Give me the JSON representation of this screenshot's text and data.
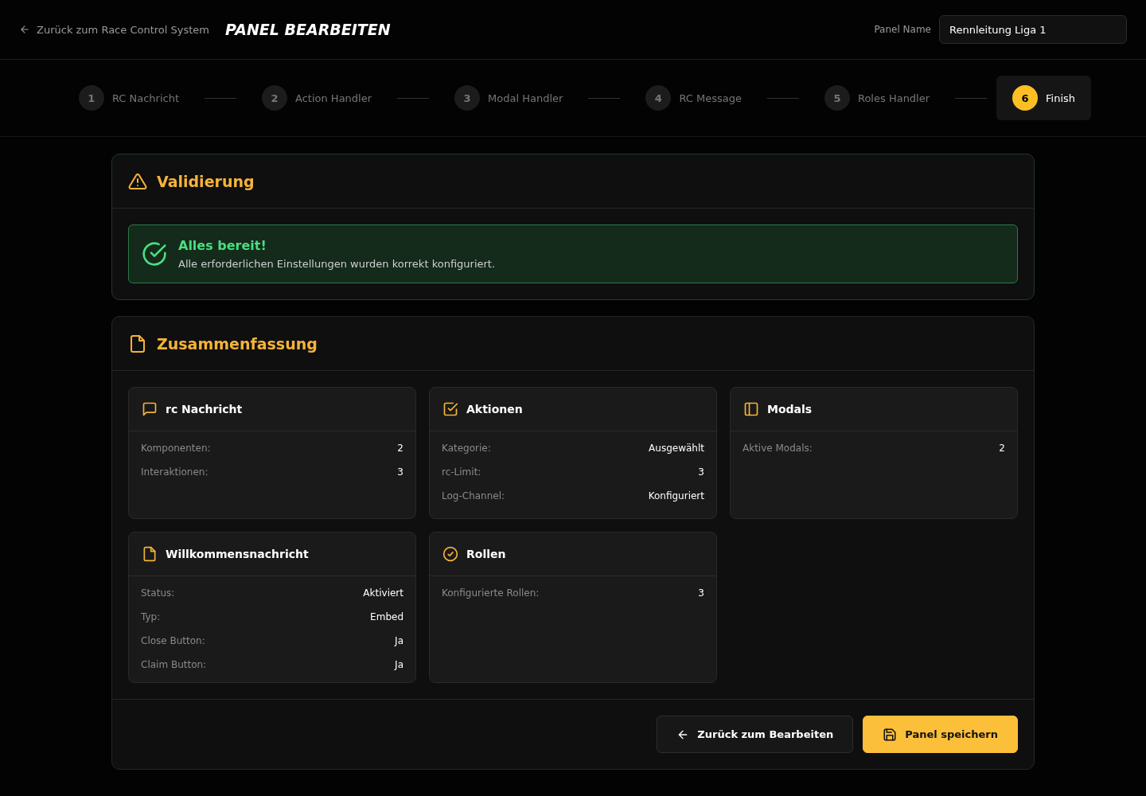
{
  "header": {
    "back_link": "Zurück zum Race Control System",
    "title": "PANEL BEARBEITEN",
    "name_label": "Panel Name",
    "name_value": "Rennleitung Liga 1"
  },
  "steps": [
    {
      "number": "1",
      "label": "RC Nachricht",
      "selected": false
    },
    {
      "number": "2",
      "label": "Action Handler",
      "selected": false
    },
    {
      "number": "3",
      "label": "Modal Handler",
      "selected": false
    },
    {
      "number": "4",
      "label": "RC Message",
      "selected": false
    },
    {
      "number": "5",
      "label": "Roles Handler",
      "selected": false
    },
    {
      "number": "6",
      "label": "Finish",
      "selected": true
    }
  ],
  "validation": {
    "title": "Validierung",
    "status_title": "Alles bereit!",
    "status_text": "Alle erforderlichen Einstellungen wurden korrekt konfiguriert."
  },
  "summary": {
    "title": "Zusammenfassung",
    "cards": [
      {
        "title": "rc Nachricht",
        "rows": [
          {
            "label": "Komponenten:",
            "value": "2"
          },
          {
            "label": "Interaktionen:",
            "value": "3"
          }
        ]
      },
      {
        "title": "Aktionen",
        "rows": [
          {
            "label": "Kategorie:",
            "value": "Ausgewählt"
          },
          {
            "label": "rc-Limit:",
            "value": "3"
          },
          {
            "label": "Log-Channel:",
            "value": "Konfiguriert"
          }
        ]
      },
      {
        "title": "Modals",
        "rows": [
          {
            "label": "Aktive Modals:",
            "value": "2"
          }
        ]
      },
      {
        "title": "Willkommensnachricht",
        "rows": [
          {
            "label": "Status:",
            "value": "Aktiviert"
          },
          {
            "label": "Typ:",
            "value": "Embed"
          },
          {
            "label": "Close Button:",
            "value": "Ja"
          },
          {
            "label": "Claim Button:",
            "value": "Ja"
          }
        ]
      },
      {
        "title": "Rollen",
        "rows": [
          {
            "label": "Konfigurierte Rollen:",
            "value": "3"
          }
        ]
      }
    ]
  },
  "buttons": {
    "back": "Zurück zum Bearbeiten",
    "save": "Panel speichern"
  }
}
